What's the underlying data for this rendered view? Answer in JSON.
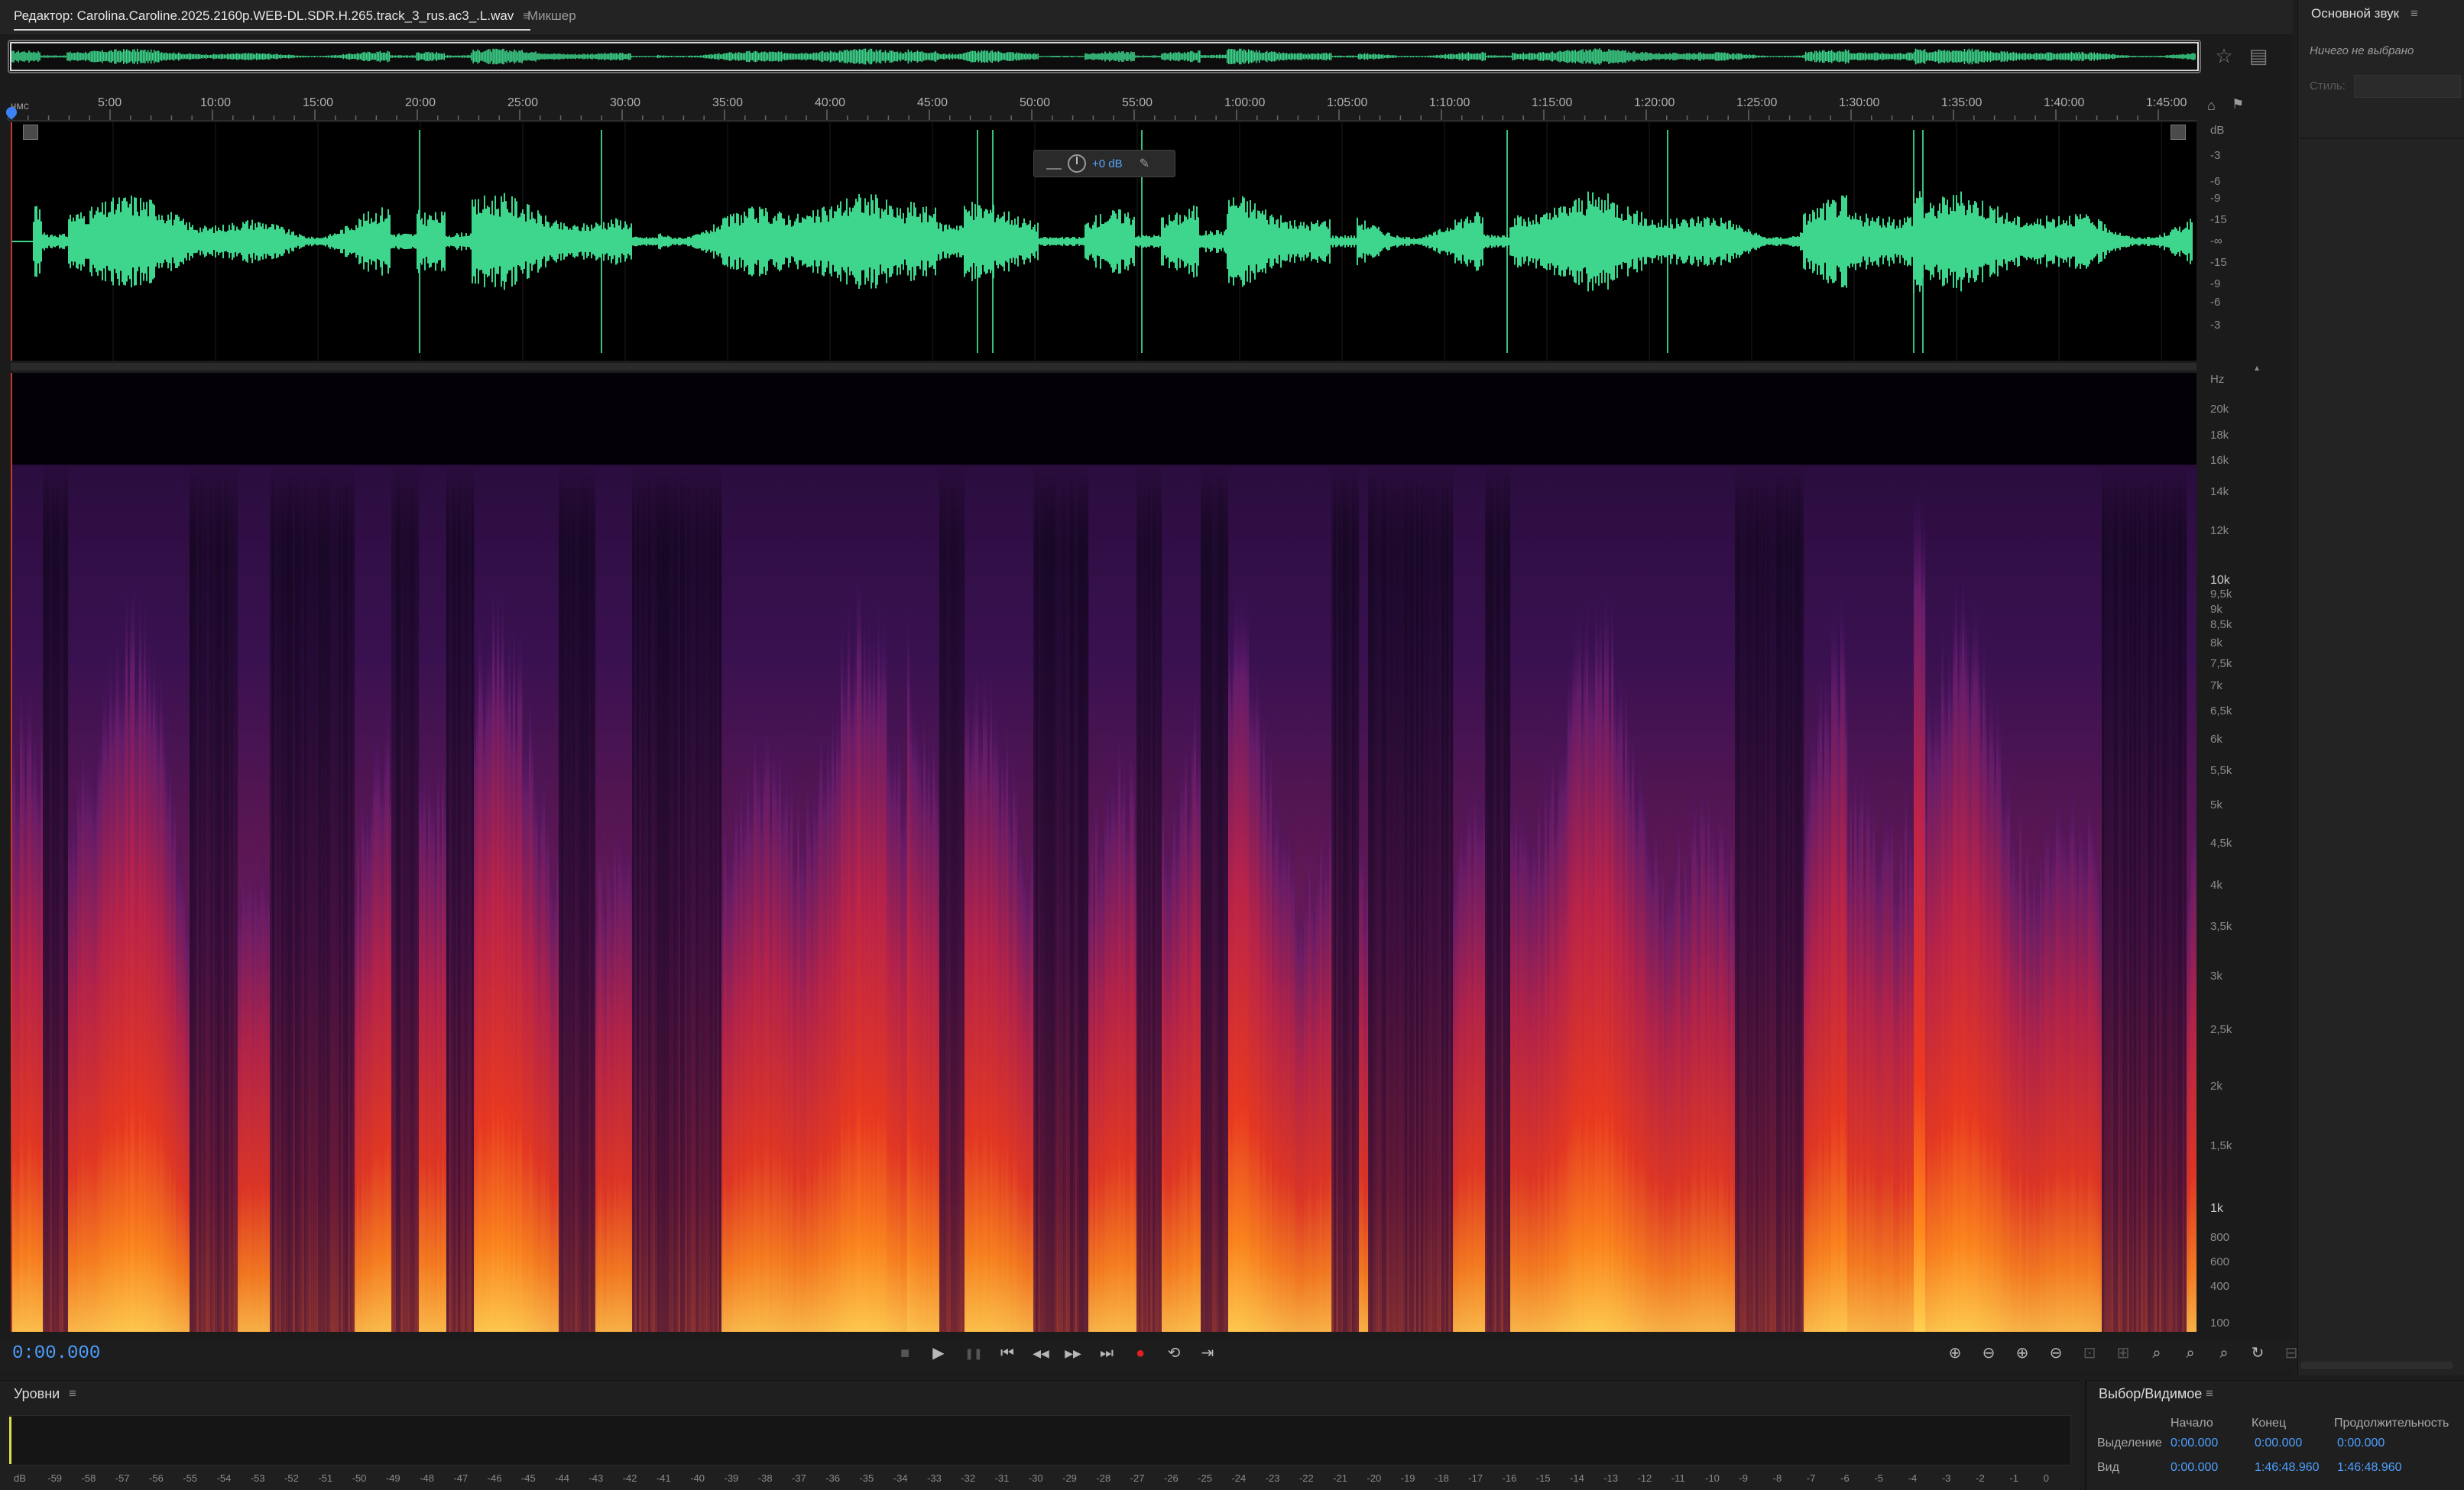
{
  "editor": {
    "tab_label": "Редактор: Carolina.Caroline.2025.2160p.WEB-DL.SDR.H.265.track_3_rus.ac3_.L.wav",
    "tab_menu_icon": "≡",
    "mixer_tab_label": "Микшер"
  },
  "ruler": {
    "unit_label": "чмс",
    "ticks": [
      "5:00",
      "10:00",
      "15:00",
      "20:00",
      "25:00",
      "30:00",
      "35:00",
      "40:00",
      "45:00",
      "50:00",
      "55:00",
      "1:00:00",
      "1:05:00",
      "1:10:00",
      "1:15:00",
      "1:20:00",
      "1:25:00",
      "1:30:00",
      "1:35:00",
      "1:40:00",
      "1:45:00"
    ]
  },
  "waveform": {
    "color": "#3dd68c",
    "db_unit": "dB",
    "db_labels": [
      "-3",
      "-6",
      "-9",
      "-15",
      "-∞",
      "-15",
      "-9",
      "-6",
      "-3"
    ]
  },
  "hud": {
    "gain_value": "+0 dB"
  },
  "spectrogram": {
    "unit": "Hz",
    "freq_labels": [
      "20k",
      "18k",
      "16k",
      "14k",
      "12k",
      "10k",
      "9,5k",
      "9k",
      "8,5k",
      "8k",
      "7,5k",
      "7k",
      "6,5k",
      "6k",
      "5,5k",
      "5k",
      "4,5k",
      "4k",
      "3,5k",
      "3k",
      "2,5k",
      "2k",
      "1,5k",
      "1k",
      "800",
      "600",
      "400",
      "100"
    ]
  },
  "transport": {
    "time": "0:00.000",
    "buttons": [
      "stop-icon",
      "play-icon",
      "pause-icon",
      "go-to-start-icon",
      "rewind-icon",
      "fast-forward-icon",
      "go-to-end-icon",
      "record-icon",
      "loop-icon",
      "skip-selection-icon"
    ],
    "zoom_buttons": [
      "zoom-in-amplitude-icon",
      "zoom-out-amplitude-icon",
      "zoom-in-time-icon",
      "zoom-out-time-icon",
      "zoom-reset-icon",
      "zoom-selection-icon",
      "zoom-in-left-icon",
      "zoom-in-right-icon",
      "zoom-full-icon",
      "zoom-out-full-icon",
      "zoom-fit-icon"
    ]
  },
  "essential_sound": {
    "title": "Основной звук",
    "menu_icon": "≡",
    "empty_message": "Ничего не выбрано",
    "style_label": "Стиль:"
  },
  "levels": {
    "title": "Уровни",
    "menu_icon": "≡",
    "scale": [
      "dB",
      "-59",
      "-58",
      "-57",
      "-56",
      "-55",
      "-54",
      "-53",
      "-52",
      "-51",
      "-50",
      "-49",
      "-48",
      "-47",
      "-46",
      "-45",
      "-44",
      "-43",
      "-42",
      "-41",
      "-40",
      "-39",
      "-38",
      "-37",
      "-36",
      "-35",
      "-34",
      "-33",
      "-32",
      "-31",
      "-30",
      "-29",
      "-28",
      "-27",
      "-26",
      "-25",
      "-24",
      "-23",
      "-22",
      "-21",
      "-20",
      "-19",
      "-18",
      "-17",
      "-16",
      "-15",
      "-14",
      "-13",
      "-12",
      "-11",
      "-10",
      "-9",
      "-8",
      "-7",
      "-6",
      "-5",
      "-4",
      "-3",
      "-2",
      "-1",
      "0"
    ]
  },
  "selection": {
    "title": "Выбор/Видимое",
    "menu_icon": "≡",
    "col_start": "Начало",
    "col_end": "Конец",
    "col_duration": "Продолжительность",
    "row_selection": "Выделение",
    "row_view": "Вид",
    "sel_start": "0:00.000",
    "sel_end": "0:00.000",
    "sel_duration": "0:00.000",
    "view_start": "0:00.000",
    "view_end": "1:46:48.960",
    "view_duration": "1:46:48.960"
  }
}
